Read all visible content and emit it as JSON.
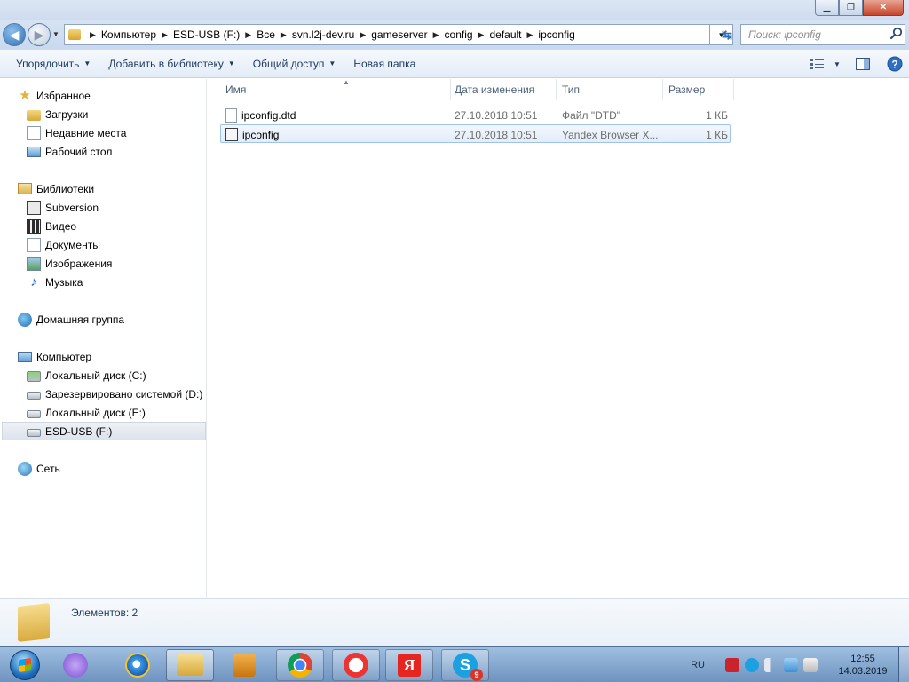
{
  "window": {
    "controls": {
      "minimize": "▁",
      "maximize": "❐",
      "close": "✕"
    }
  },
  "address_bar": {
    "crumbs": [
      "Компьютер",
      "ESD-USB (F:)",
      "Все",
      "svn.l2j-dev.ru",
      "gameserver",
      "config",
      "default",
      "ipconfig"
    ],
    "search_placeholder": "Поиск: ipconfig"
  },
  "toolbar": {
    "organize": "Упорядочить",
    "add_to_library": "Добавить в библиотеку",
    "share": "Общий доступ",
    "new_folder": "Новая папка"
  },
  "sidebar": {
    "favorites": "Избранное",
    "favorites_items": [
      "Загрузки",
      "Недавние места",
      "Рабочий стол"
    ],
    "libraries": "Библиотеки",
    "libraries_items": [
      "Subversion",
      "Видео",
      "Документы",
      "Изображения",
      "Музыка"
    ],
    "homegroup": "Домашняя группа",
    "computer": "Компьютер",
    "computer_items": [
      "Локальный диск (C:)",
      "Зарезервировано системой (D:)",
      "Локальный диск (E:)",
      "ESD-USB (F:)"
    ],
    "network": "Сеть"
  },
  "columns": {
    "name": "Имя",
    "date": "Дата изменения",
    "type": "Тип",
    "size": "Размер"
  },
  "files": [
    {
      "name": "ipconfig.dtd",
      "date": "27.10.2018 10:51",
      "type": "Файл \"DTD\"",
      "size": "1 КБ"
    },
    {
      "name": "ipconfig",
      "date": "27.10.2018 10:51",
      "type": "Yandex Browser X...",
      "size": "1 КБ"
    }
  ],
  "details": {
    "count": "Элементов: 2"
  },
  "taskbar": {
    "lang": "RU",
    "time": "12:55",
    "date": "14.03.2019",
    "skype_badge": "9"
  }
}
